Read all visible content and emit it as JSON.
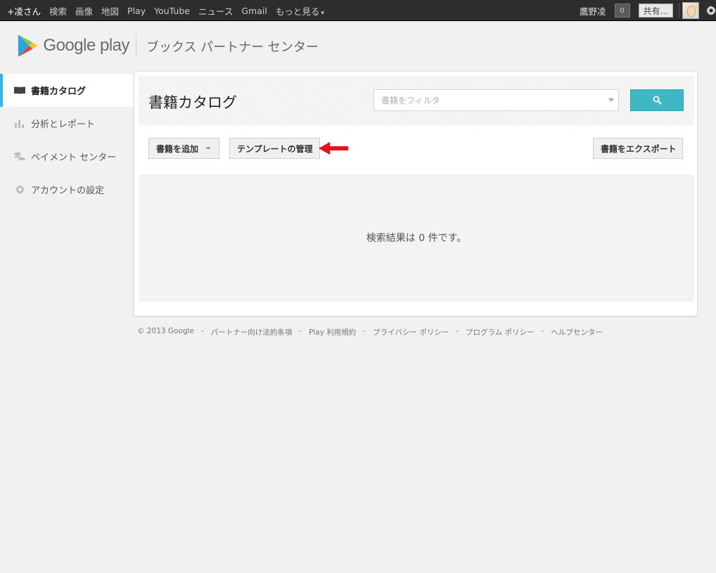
{
  "gbar": {
    "items": [
      "+凌さん",
      "検索",
      "画像",
      "地図",
      "Play",
      "YouTube",
      "ニュース",
      "Gmail"
    ],
    "more": "もっと見る",
    "user": "鷹野凌",
    "notifications": "0",
    "share": "共有..."
  },
  "header": {
    "logo_text": "Google play",
    "title": "ブックス パートナー センター"
  },
  "sidebar": {
    "items": [
      {
        "label": "書籍カタログ",
        "icon": "book-icon",
        "active": true
      },
      {
        "label": "分析とレポート",
        "icon": "bar-chart-icon",
        "active": false
      },
      {
        "label": "ペイメント センター",
        "icon": "coins-icon",
        "active": false
      },
      {
        "label": "アカウントの設定",
        "icon": "gear-icon",
        "active": false
      }
    ]
  },
  "main": {
    "title": "書籍カタログ",
    "filter_placeholder": "書籍をフィルタ",
    "add_book": "書籍を追加",
    "manage_templates": "テンプレートの管理",
    "export_books": "書籍をエクスポート",
    "no_results": "検索結果は 0 件です。"
  },
  "footer": {
    "copyright": "© 2013 Google",
    "links": [
      "パートナー向け法的条項",
      "Play 利用規約",
      "プライバシー ポリシー",
      "プログラム ポリシー",
      "ヘルプセンター"
    ],
    "separator": "-"
  },
  "colors": {
    "accent": "#33b5e5",
    "search_button": "#3fb8c6",
    "arrow": "#e8101a",
    "topbar": "#2d2d2d"
  }
}
